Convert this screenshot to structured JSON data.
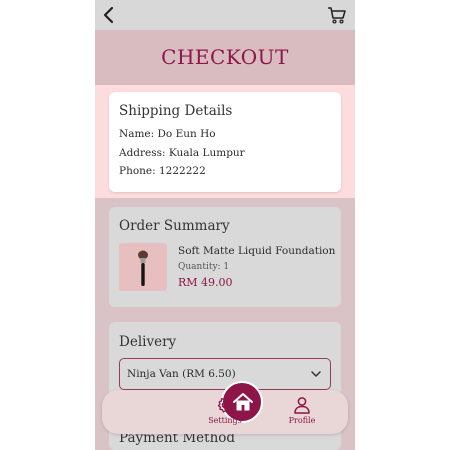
{
  "colors": {
    "accent": "#8e1547",
    "background": "#d9c3c6",
    "shipping_band": "#fcdcdd",
    "card_gray": "#d9d9d9"
  },
  "topbar": {
    "back_icon": "chevron-left-icon",
    "cart_icon": "cart-icon"
  },
  "header": {
    "title": "CHECKOUT"
  },
  "shipping": {
    "title": "Shipping Details",
    "name": "Name: Do Eun Ho",
    "address": "Address: Kuala Lumpur",
    "phone": "Phone: 1222222"
  },
  "order": {
    "title": "Order Summary",
    "item": {
      "name": "Soft Matte Liquid Foundation",
      "quantity": "Quantity: 1",
      "price": "RM 49.00",
      "image_icon": "makeup-brush-icon"
    }
  },
  "delivery": {
    "title": "Delivery",
    "selected": "Ninja Van (RM 6.50)"
  },
  "payment": {
    "title": "Payment Method"
  },
  "nav": {
    "home_icon": "home-icon",
    "settings_label": "Settings",
    "profile_label": "Profile"
  }
}
